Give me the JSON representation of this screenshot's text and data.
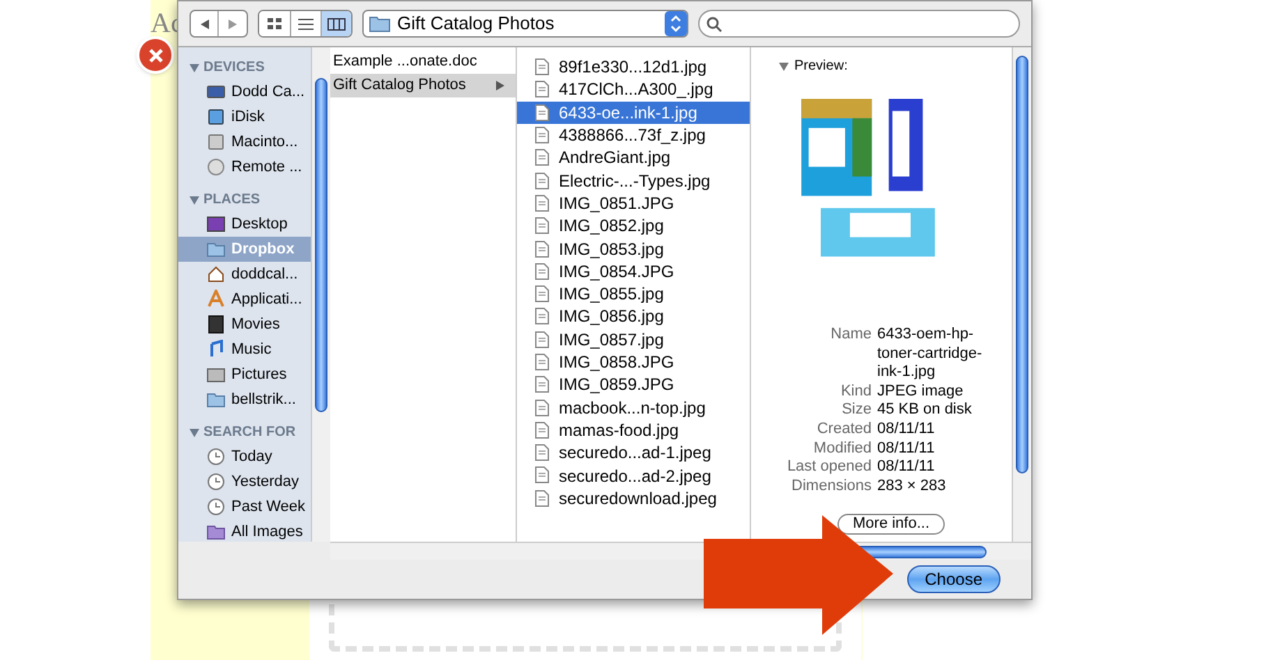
{
  "page": {
    "heading": "Ac"
  },
  "toolbar": {
    "view_modes": [
      {
        "kind": "icons",
        "selected": false
      },
      {
        "kind": "list",
        "selected": false
      },
      {
        "kind": "columns",
        "selected": true
      }
    ],
    "path": "Gift Catalog Photos"
  },
  "sidebar": [
    {
      "title": "DEVICES",
      "items": [
        {
          "label": "Dodd Ca...",
          "kind": "computer",
          "selected": false
        },
        {
          "label": "iDisk",
          "kind": "idisk",
          "selected": false
        },
        {
          "label": "Macinto...",
          "kind": "drive",
          "selected": false
        },
        {
          "label": "Remote ...",
          "kind": "disc",
          "selected": false
        }
      ]
    },
    {
      "title": "PLACES",
      "items": [
        {
          "label": "Desktop",
          "kind": "desktop",
          "selected": false
        },
        {
          "label": "Dropbox",
          "kind": "folder",
          "selected": true
        },
        {
          "label": "doddcal...",
          "kind": "home",
          "selected": false
        },
        {
          "label": "Applicati...",
          "kind": "apps",
          "selected": false
        },
        {
          "label": "Movies",
          "kind": "movies",
          "selected": false
        },
        {
          "label": "Music",
          "kind": "music",
          "selected": false
        },
        {
          "label": "Pictures",
          "kind": "pictures",
          "selected": false
        },
        {
          "label": "bellstrik...",
          "kind": "folder",
          "selected": false
        }
      ]
    },
    {
      "title": "SEARCH FOR",
      "items": [
        {
          "label": "Today",
          "kind": "clock",
          "selected": false
        },
        {
          "label": "Yesterday",
          "kind": "clock",
          "selected": false
        },
        {
          "label": "Past Week",
          "kind": "clock",
          "selected": false
        },
        {
          "label": "All Images",
          "kind": "smartfolder",
          "selected": false
        }
      ]
    }
  ],
  "column_1": [
    {
      "label": "Example ...onate.doc",
      "folder": false,
      "selected": false
    },
    {
      "label": "Gift Catalog Photos",
      "folder": true,
      "selected": true
    }
  ],
  "column_2": [
    {
      "label": "89f1e330...12d1.jpg",
      "selected": false
    },
    {
      "label": "417ClCh...A300_.jpg",
      "selected": false
    },
    {
      "label": "6433-oe...ink-1.jpg",
      "selected": true
    },
    {
      "label": "4388866...73f_z.jpg",
      "selected": false
    },
    {
      "label": "AndreGiant.jpg",
      "selected": false
    },
    {
      "label": "Electric-...-Types.jpg",
      "selected": false
    },
    {
      "label": "IMG_0851.JPG",
      "selected": false
    },
    {
      "label": "IMG_0852.jpg",
      "selected": false
    },
    {
      "label": "IMG_0853.jpg",
      "selected": false
    },
    {
      "label": "IMG_0854.JPG",
      "selected": false
    },
    {
      "label": "IMG_0855.jpg",
      "selected": false
    },
    {
      "label": "IMG_0856.jpg",
      "selected": false
    },
    {
      "label": "IMG_0857.jpg",
      "selected": false
    },
    {
      "label": "IMG_0858.JPG",
      "selected": false
    },
    {
      "label": "IMG_0859.JPG",
      "selected": false
    },
    {
      "label": "macbook...n-top.jpg",
      "selected": false
    },
    {
      "label": "mamas-food.jpg",
      "selected": false
    },
    {
      "label": "securedo...ad-1.jpeg",
      "selected": false
    },
    {
      "label": "securedo...ad-2.jpeg",
      "selected": false
    },
    {
      "label": "securedownload.jpeg",
      "selected": false
    }
  ],
  "preview": {
    "title": "Preview:",
    "info": [
      {
        "label": "Name",
        "value": "6433-oem-hp-toner-cartridge-ink-1.jpg"
      },
      {
        "label": "Kind",
        "value": "JPEG image"
      },
      {
        "label": "Size",
        "value": "45 KB on disk"
      },
      {
        "label": "Created",
        "value": "08/11/11"
      },
      {
        "label": "Modified",
        "value": "08/11/11"
      },
      {
        "label": "Last opened",
        "value": "08/11/11"
      },
      {
        "label": "Dimensions",
        "value": "283 × 283"
      }
    ],
    "more_button": "More info..."
  },
  "choose_button": "Choose"
}
